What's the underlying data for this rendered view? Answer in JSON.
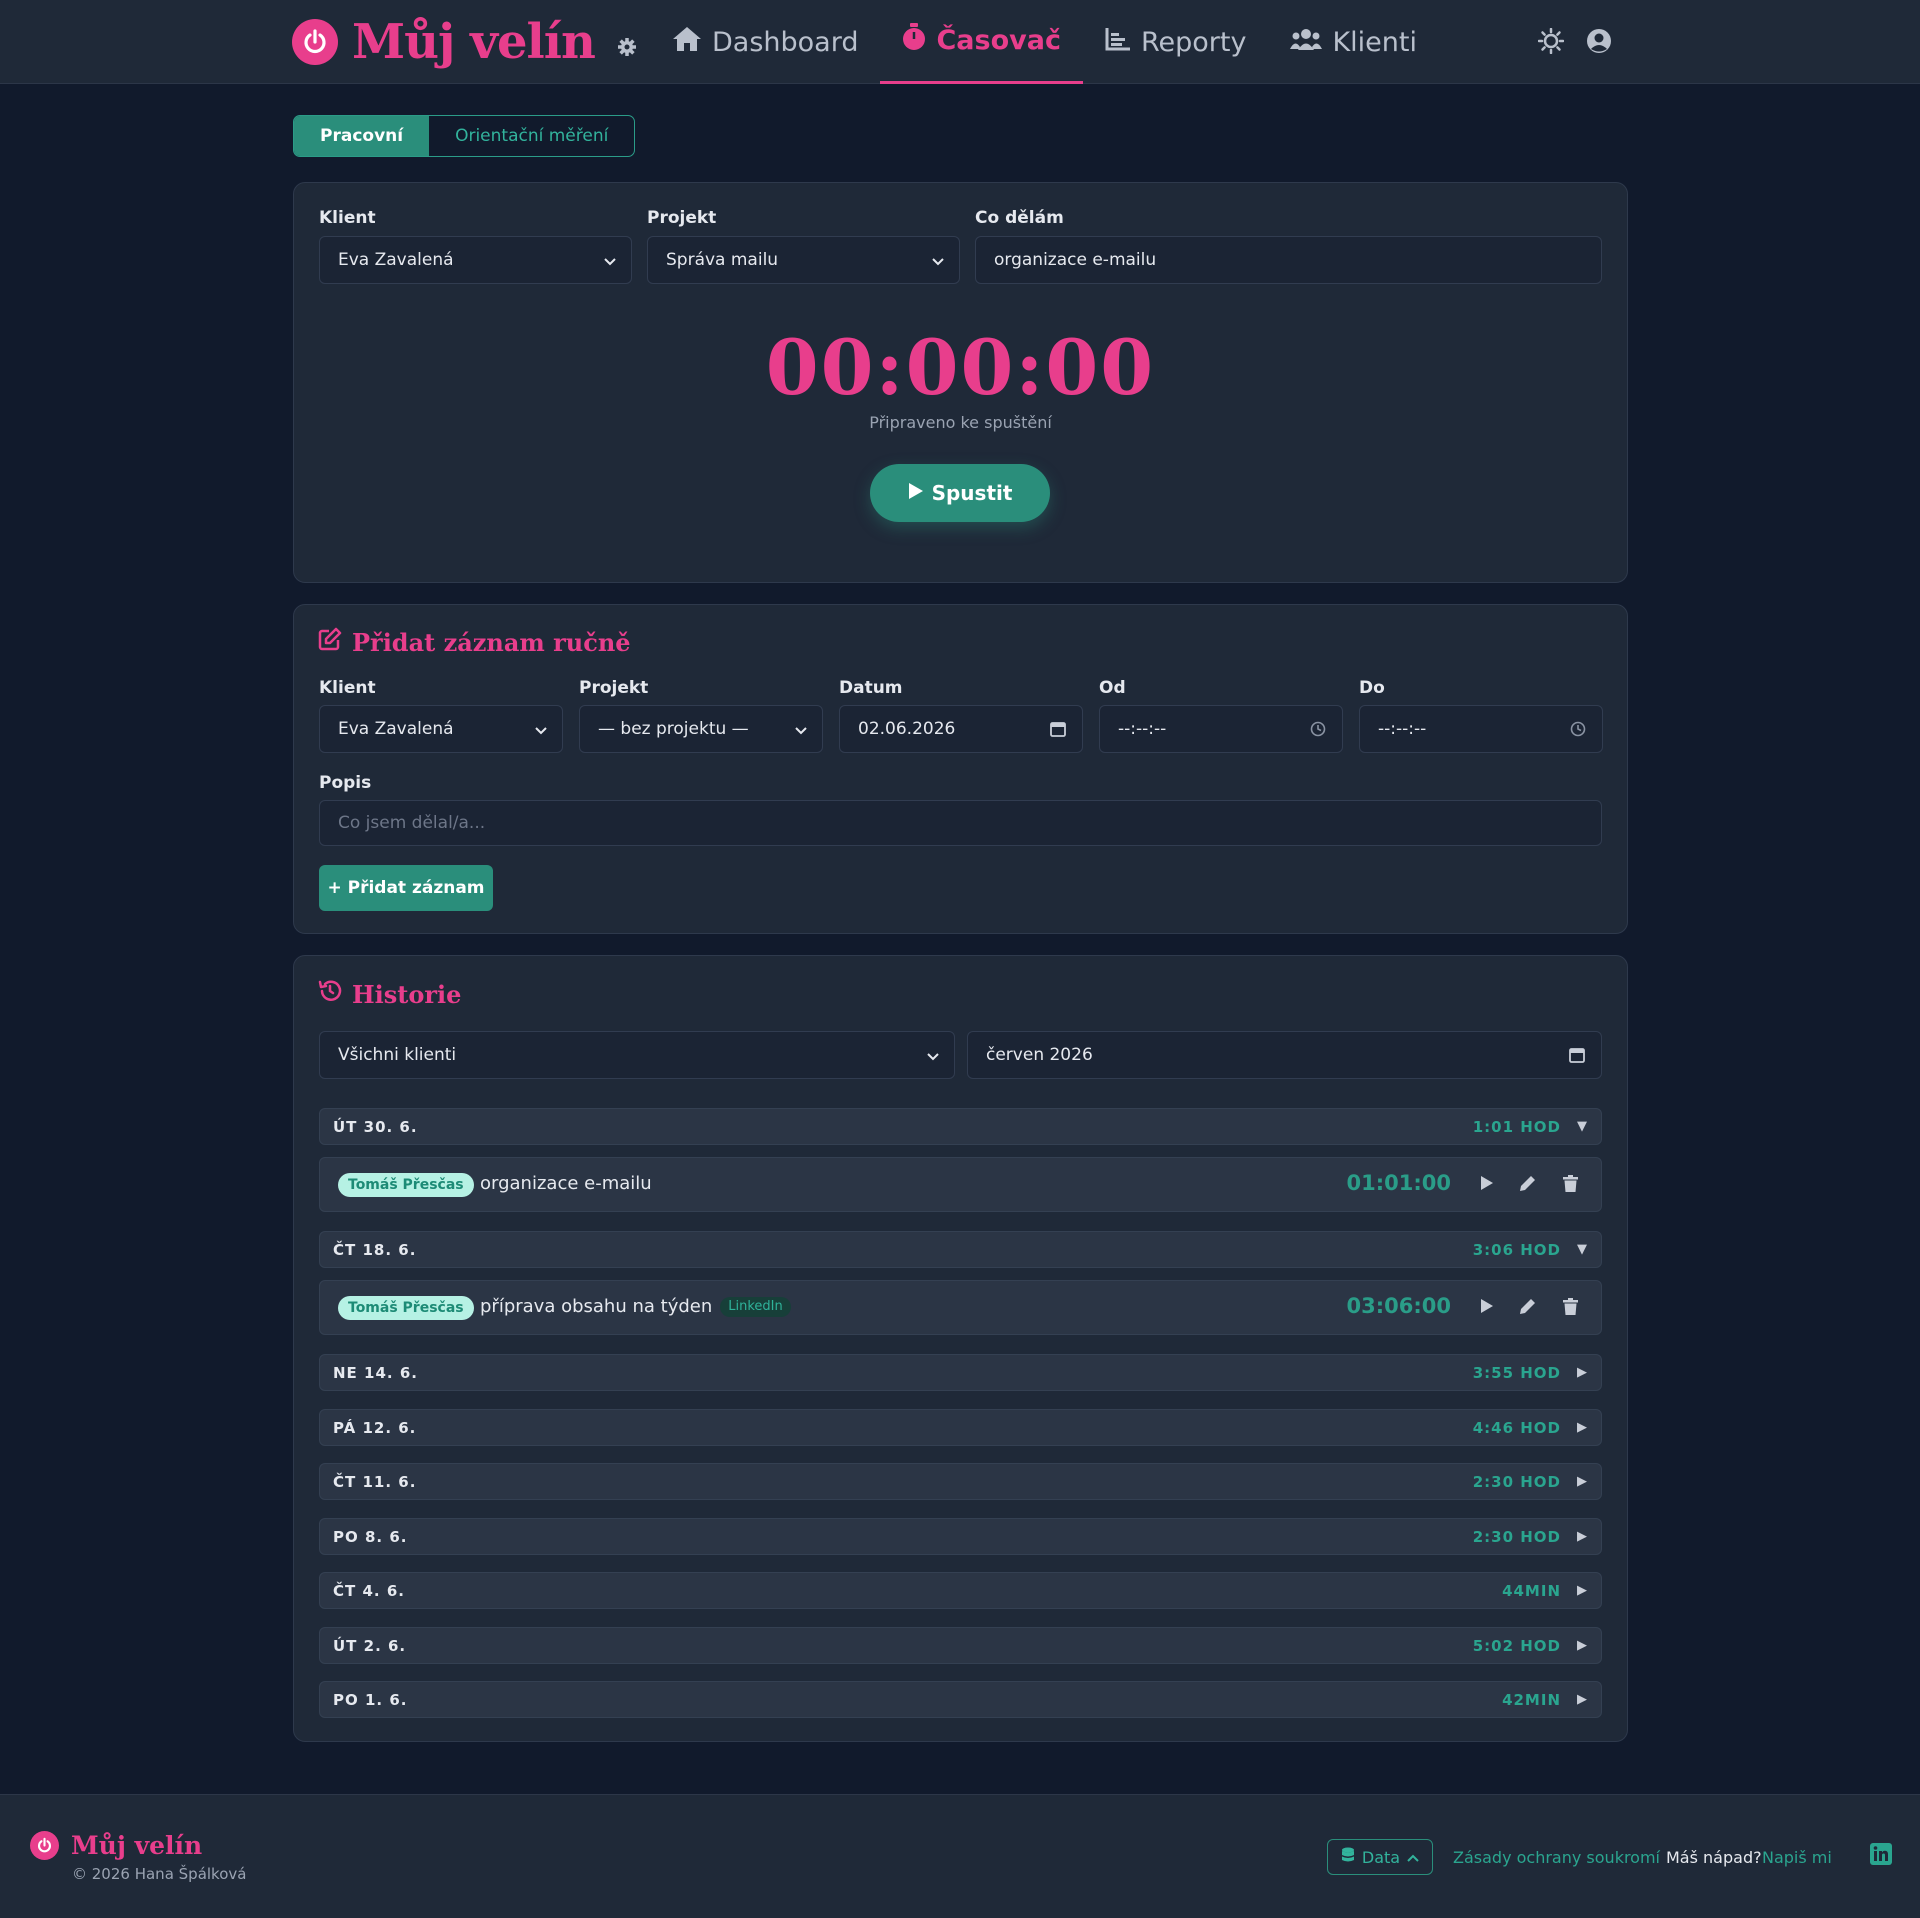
{
  "app": {
    "name": "Můj velín"
  },
  "nav": {
    "items": [
      {
        "label": "Dashboard",
        "icon": "home-icon"
      },
      {
        "label": "Časovač",
        "icon": "stopwatch-icon",
        "active": true
      },
      {
        "label": "Reporty",
        "icon": "chart-icon"
      },
      {
        "label": "Klienti",
        "icon": "users-icon"
      }
    ]
  },
  "mode_tabs": {
    "work": "Pracovní",
    "estimate": "Orientační měření"
  },
  "timer_card": {
    "client_label": "Klient",
    "client_value": "Eva Zavalená",
    "project_label": "Projekt",
    "project_value": "Správa mailu",
    "task_label": "Co dělám",
    "task_value": "organizace e-mailu",
    "time": "00:00:00",
    "status": "Připraveno ke spuštění",
    "start_label": "Spustit"
  },
  "manual": {
    "title": "Přidat záznam ručně",
    "client_label": "Klient",
    "client_value": "Eva Zavalená",
    "project_label": "Projekt",
    "project_value": "— bez projektu —",
    "date_label": "Datum",
    "date_value": "02.06.2026",
    "from_label": "Od",
    "from_value": "--:--:--",
    "to_label": "Do",
    "to_value": "--:--:--",
    "desc_label": "Popis",
    "desc_placeholder": "Co jsem dělal/a...",
    "add_label": "+ Přidat záznam"
  },
  "history": {
    "title": "Historie",
    "client_filter": "Všichni klienti",
    "month_filter": "červen 2026",
    "days": [
      {
        "label": "ÚT 30. 6.",
        "total": "1:01 HOD",
        "expanded": true,
        "entries": [
          {
            "client": "Tomáš Přesčas",
            "text": "organizace e-mailu",
            "tag": "",
            "duration": "01:01:00"
          }
        ]
      },
      {
        "label": "ČT 18. 6.",
        "total": "3:06 HOD",
        "expanded": true,
        "entries": [
          {
            "client": "Tomáš Přesčas",
            "text": "příprava obsahu na týden",
            "tag": "LinkedIn",
            "duration": "03:06:00"
          }
        ]
      },
      {
        "label": "NE 14. 6.",
        "total": "3:55 HOD",
        "expanded": false,
        "entries": []
      },
      {
        "label": "PÁ 12. 6.",
        "total": "4:46 HOD",
        "expanded": false,
        "entries": []
      },
      {
        "label": "ČT 11. 6.",
        "total": "2:30 HOD",
        "expanded": false,
        "entries": []
      },
      {
        "label": "PO 8. 6.",
        "total": "2:30 HOD",
        "expanded": false,
        "entries": []
      },
      {
        "label": "ČT 4. 6.",
        "total": "44MIN",
        "expanded": false,
        "entries": []
      },
      {
        "label": "ÚT 2. 6.",
        "total": "5:02 HOD",
        "expanded": false,
        "entries": []
      },
      {
        "label": "PO 1. 6.",
        "total": "42MIN",
        "expanded": false,
        "entries": []
      }
    ]
  },
  "footer": {
    "brand": "Můj velín",
    "copyright": "© 2026 Hana Špálková",
    "data_label": "Data",
    "privacy": "Zásady ochrany soukromí",
    "idea_prefix": "Máš nápad?",
    "idea_link": "Napiš mi"
  },
  "colors": {
    "accent": "#e83e8c",
    "teal": "#2a8e7b",
    "background": "#111a2c",
    "card": "#1f2938"
  }
}
